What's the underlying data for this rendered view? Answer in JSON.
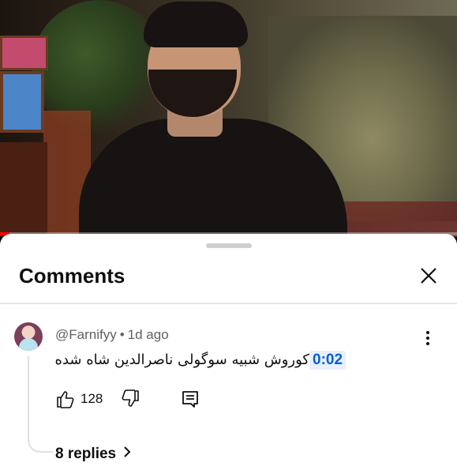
{
  "video": {
    "progress_fraction": 0.02
  },
  "comments_panel": {
    "title": "Comments",
    "close_icon": "close-icon"
  },
  "comment": {
    "author": "@Farnifyy",
    "separator": "•",
    "age": "1d ago",
    "timestamp_link": "0:02",
    "text": "کوروش شبیه سوگولی ناصرالدین شاه شده",
    "like_count": "128",
    "icons": [
      "thumb-up-icon",
      "thumb-down-icon",
      "reply-icon",
      "more-vert-icon"
    ]
  },
  "replies": {
    "label": "8 replies"
  },
  "colors": {
    "timestamp_bg": "#e8f0fe",
    "timestamp_fg": "#065fd4",
    "progress": "#ff0000"
  }
}
